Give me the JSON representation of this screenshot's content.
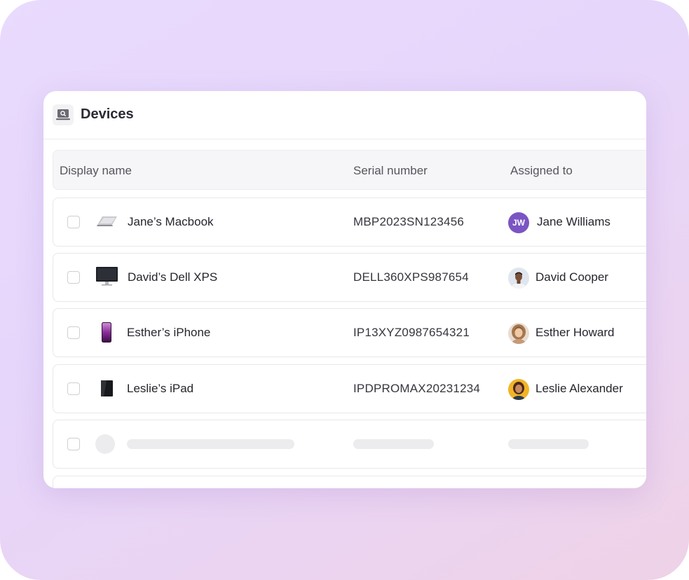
{
  "panel": {
    "title": "Devices",
    "icon": "laptop-search-icon"
  },
  "table": {
    "columns": [
      "Display name",
      "Serial number",
      "Assigned to"
    ],
    "rows": [
      {
        "device": "Jane’s Macbook",
        "device_icon": "laptop-icon",
        "serial": "MBP2023SN123456",
        "assignee": "Jane Williams",
        "avatar_initials": "JW"
      },
      {
        "device": "David’s Dell XPS",
        "device_icon": "monitor-icon",
        "serial": "DELL360XPS987654",
        "assignee": "David Cooper",
        "avatar_initials": ""
      },
      {
        "device": "Esther’s iPhone",
        "device_icon": "phone-icon",
        "serial": "IP13XYZ0987654321",
        "assignee": "Esther Howard",
        "avatar_initials": ""
      },
      {
        "device": "Leslie’s iPad",
        "device_icon": "tablet-icon",
        "serial": "IPDPROMAX20231234",
        "assignee": "Leslie Alexander",
        "avatar_initials": ""
      }
    ]
  },
  "colors": {
    "background_gradient": [
      "#e9dbfd",
      "#efd2e6"
    ],
    "avatar_accent": "#7b55c3"
  }
}
